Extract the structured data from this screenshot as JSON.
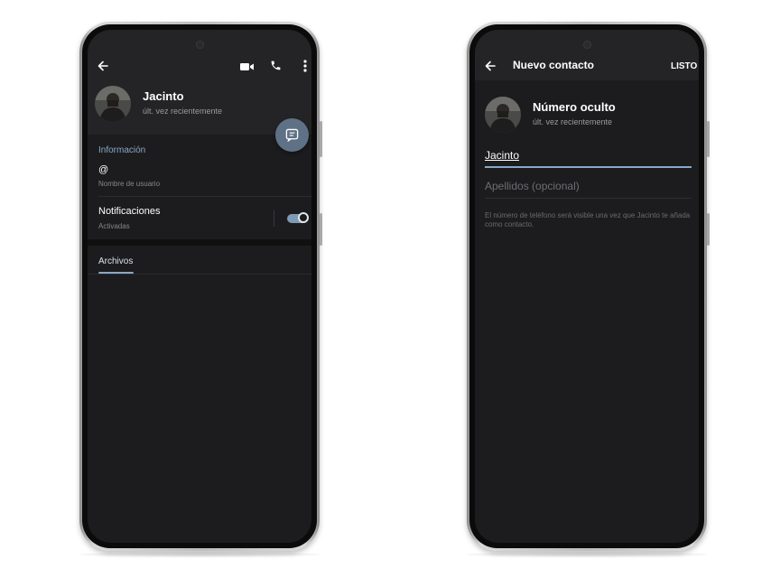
{
  "profile_screen": {
    "contact_name": "Jacinto",
    "last_seen": "últ. vez recientemente",
    "info_section_label": "Información",
    "username_value": "@",
    "username_caption": "Nombre de usuario",
    "notifications_label": "Notificaciones",
    "notifications_status": "Activadas",
    "notifications_enabled": true,
    "files_tab_label": "Archivos",
    "icons": [
      "back-arrow-icon",
      "video-camera-icon",
      "phone-icon",
      "more-vertical-icon",
      "message-icon"
    ]
  },
  "new_contact_screen": {
    "title": "Nuevo contacto",
    "done_label": "LISTO",
    "contact_name": "Número oculto",
    "last_seen": "últ. vez recientemente",
    "first_name_value": "Jacinto",
    "last_name_placeholder": "Apellidos (opcional)",
    "info_text": "El número de teléfono será visible una vez que Jacinto te añada como contacto.",
    "icons": [
      "back-arrow-icon"
    ]
  },
  "colors": {
    "screen_bg": "#1c1c1e",
    "header_bg": "#242426",
    "accent": "#8aa7c7",
    "fab": "#5f7186"
  }
}
